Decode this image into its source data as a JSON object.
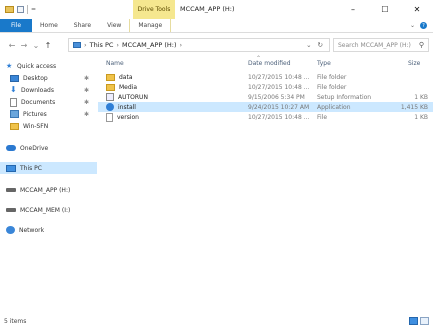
{
  "titlebar": {
    "contextual_tab": "Drive Tools",
    "title": "MCCAM_APP (H:)",
    "minimize": "–",
    "maximize": "☐",
    "close": "✕"
  },
  "ribbon": {
    "tabs": [
      "File",
      "Home",
      "Share",
      "View",
      "Manage"
    ]
  },
  "address": {
    "back": "←",
    "forward": "→",
    "recent": "⌄",
    "up": "↑",
    "crumbs": [
      "This PC",
      "MCCAM_APP (H:)"
    ],
    "sep": "›",
    "refresh": "↻",
    "dropdown": "⌄",
    "search_placeholder": "Search MCCAM_APP (H:)"
  },
  "nav": {
    "items": [
      {
        "label": "Quick access",
        "icon": "star-icon"
      },
      {
        "label": "Desktop",
        "icon": "folder-icon",
        "pinned": true
      },
      {
        "label": "Downloads",
        "icon": "download-icon",
        "pinned": true
      },
      {
        "label": "Documents",
        "icon": "document-icon",
        "pinned": true
      },
      {
        "label": "Pictures",
        "icon": "pictures-icon",
        "pinned": true
      },
      {
        "label": "Win-SFN",
        "icon": "folder-icon"
      },
      {
        "label": "OneDrive",
        "icon": "cloud-icon"
      },
      {
        "label": "This PC",
        "icon": "computer-icon",
        "selected": true
      },
      {
        "label": "MCCAM_APP (H:)",
        "icon": "drive-icon"
      },
      {
        "label": "MCCAM_MEM (I:)",
        "icon": "drive-icon"
      },
      {
        "label": "Network",
        "icon": "network-icon"
      }
    ],
    "pin_glyph": "✱"
  },
  "list": {
    "headers": {
      "name": "Name",
      "date": "Date modified",
      "type": "Type",
      "size": "Size"
    },
    "rows": [
      {
        "name": "data",
        "date": "10/27/2015 10:48 ...",
        "type": "File folder",
        "size": "",
        "icon": "folder-icon"
      },
      {
        "name": "Media",
        "date": "10/27/2015 10:48 ...",
        "type": "File folder",
        "size": "",
        "icon": "folder-icon"
      },
      {
        "name": "AUTORUN",
        "date": "9/15/2006 5:34 PM",
        "type": "Setup Information",
        "size": "1 KB",
        "icon": "setup-icon"
      },
      {
        "name": "install",
        "date": "9/24/2015 10:27 AM",
        "type": "Application",
        "size": "1,415 KB",
        "icon": "app-icon",
        "selected": true
      },
      {
        "name": "version",
        "date": "10/27/2015 10:48 ...",
        "type": "File",
        "size": "1 KB",
        "icon": "file-icon"
      }
    ]
  },
  "status": {
    "count": "5 items"
  }
}
